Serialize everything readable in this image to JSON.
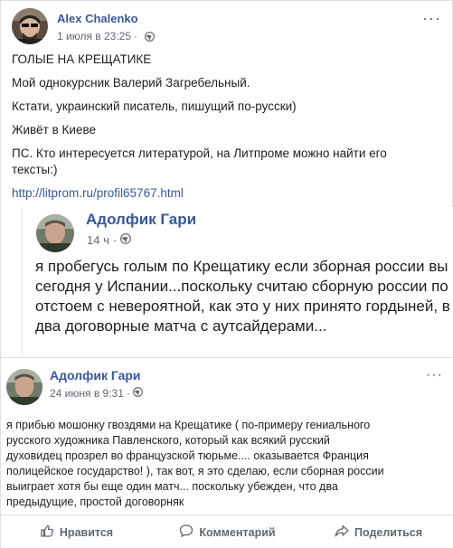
{
  "post": {
    "author": "Alex Chalenko",
    "timestamp": "1 июля в 23:25",
    "privacy_icon": "globe-icon",
    "more_icon": "ellipsis-icon",
    "lines": [
      "ГОЛЫЕ НА КРЕЩАТИКЕ",
      "Мой однокурсник Валерий Загребельный.",
      "Кстати, украинский писатель, пишущий по-русски)",
      "Живёт в Киеве",
      "ПС. Кто интересуется литературой, на Литпроме можно найти его тексты:)"
    ],
    "link": "http://litprom.ru/profil65767.html"
  },
  "screenshot1": {
    "author": "Адолфик Гари",
    "timestamp": "14 ч",
    "lines": [
      "я пробегусь голым по Крещатику если зборная россии вы",
      "сегодня у Испании...поскольку считаю сборную россии по",
      "отстоем с невероятной, как это у них принято гордыней, в",
      "два договорные матча с аутсайдерами..."
    ]
  },
  "screenshot2": {
    "author": "Адолфик Гари",
    "timestamp": "24 июня в 9:31",
    "lines": [
      "я прибью мошонку гвоздями на Крещатике ( по-примеру гениального",
      "русского художника Павленского, который как всякий русский",
      "духовидец прозрел во французской тюрьме.... оказывается Франция",
      "полицейское государство! ), так вот, я это сделаю, если сборная россии",
      "выиграет хотя бы еще один матч... поскольку убежден, что два",
      "предыдущие, простой договорняк"
    ]
  },
  "actions": {
    "like": "Нравится",
    "comment": "Комментарий",
    "share": "Поделиться"
  },
  "colors": {
    "link": "#385898",
    "meta": "#616770",
    "border": "#dddfe2"
  }
}
